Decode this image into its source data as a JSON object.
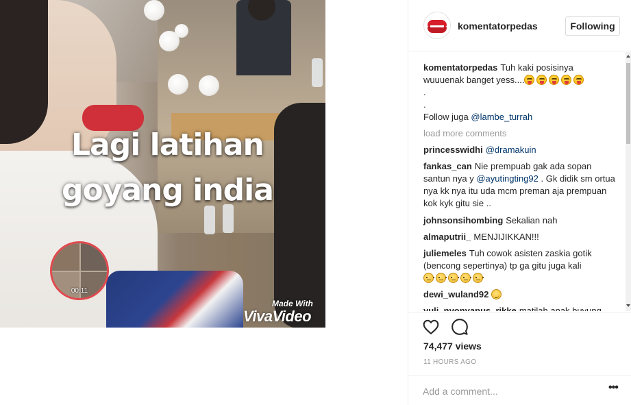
{
  "video": {
    "overlay_line1": "Lagi latihan",
    "overlay_line2": "goyang india",
    "pip_time": "00:11",
    "watermark_small": "Made With",
    "watermark_brand": "VivaVideo"
  },
  "header": {
    "username": "komentatorpedas",
    "follow_label": "Following"
  },
  "caption": {
    "user": "komentatorpedas",
    "line1": "Tuh kaki posisinya",
    "line2": "wuuuenak banget yess....",
    "dot1": ".",
    "dot2": ".",
    "follow_prefix": "Follow juga ",
    "follow_mention": "@lambe_turrah"
  },
  "load_more": "load more comments",
  "comments": [
    {
      "user": "princesswidhi",
      "text": "",
      "mention": "@dramakuin"
    },
    {
      "user": "fankas_can",
      "text": "Nie prempuab gak ada sopan santun nya y",
      "mention": "@ayutingting92",
      "text2": ". Gk didik sm ortua nya kk nya itu uda mcm preman aja prempuan kok kyk gitu sie .."
    },
    {
      "user": "johnsonsihombing",
      "text": "Sekalian nah"
    },
    {
      "user": "almaputrii_",
      "text": "MENJIJIKKAN!!!"
    },
    {
      "user": "juliemeles",
      "text": "Tuh cowok asisten zaskia gotik (bencong sepertinya) tp ga gitu juga kali"
    },
    {
      "user": "dewi_wuland92",
      "text": ""
    },
    {
      "user": "yuli_nyonyapus_rikke",
      "text": "matilah anak buyung"
    }
  ],
  "stats": {
    "views": "74,477 views",
    "time_ago": "11 HOURS AGO"
  },
  "comment_box": {
    "placeholder": "Add a comment..."
  },
  "icons": {
    "like": "heart-icon",
    "comment": "comment-bubble-icon",
    "more": "more-options-icon"
  },
  "colors": {
    "mention": "#003569",
    "muted": "#999999",
    "text": "#262626",
    "border": "#efefef"
  }
}
